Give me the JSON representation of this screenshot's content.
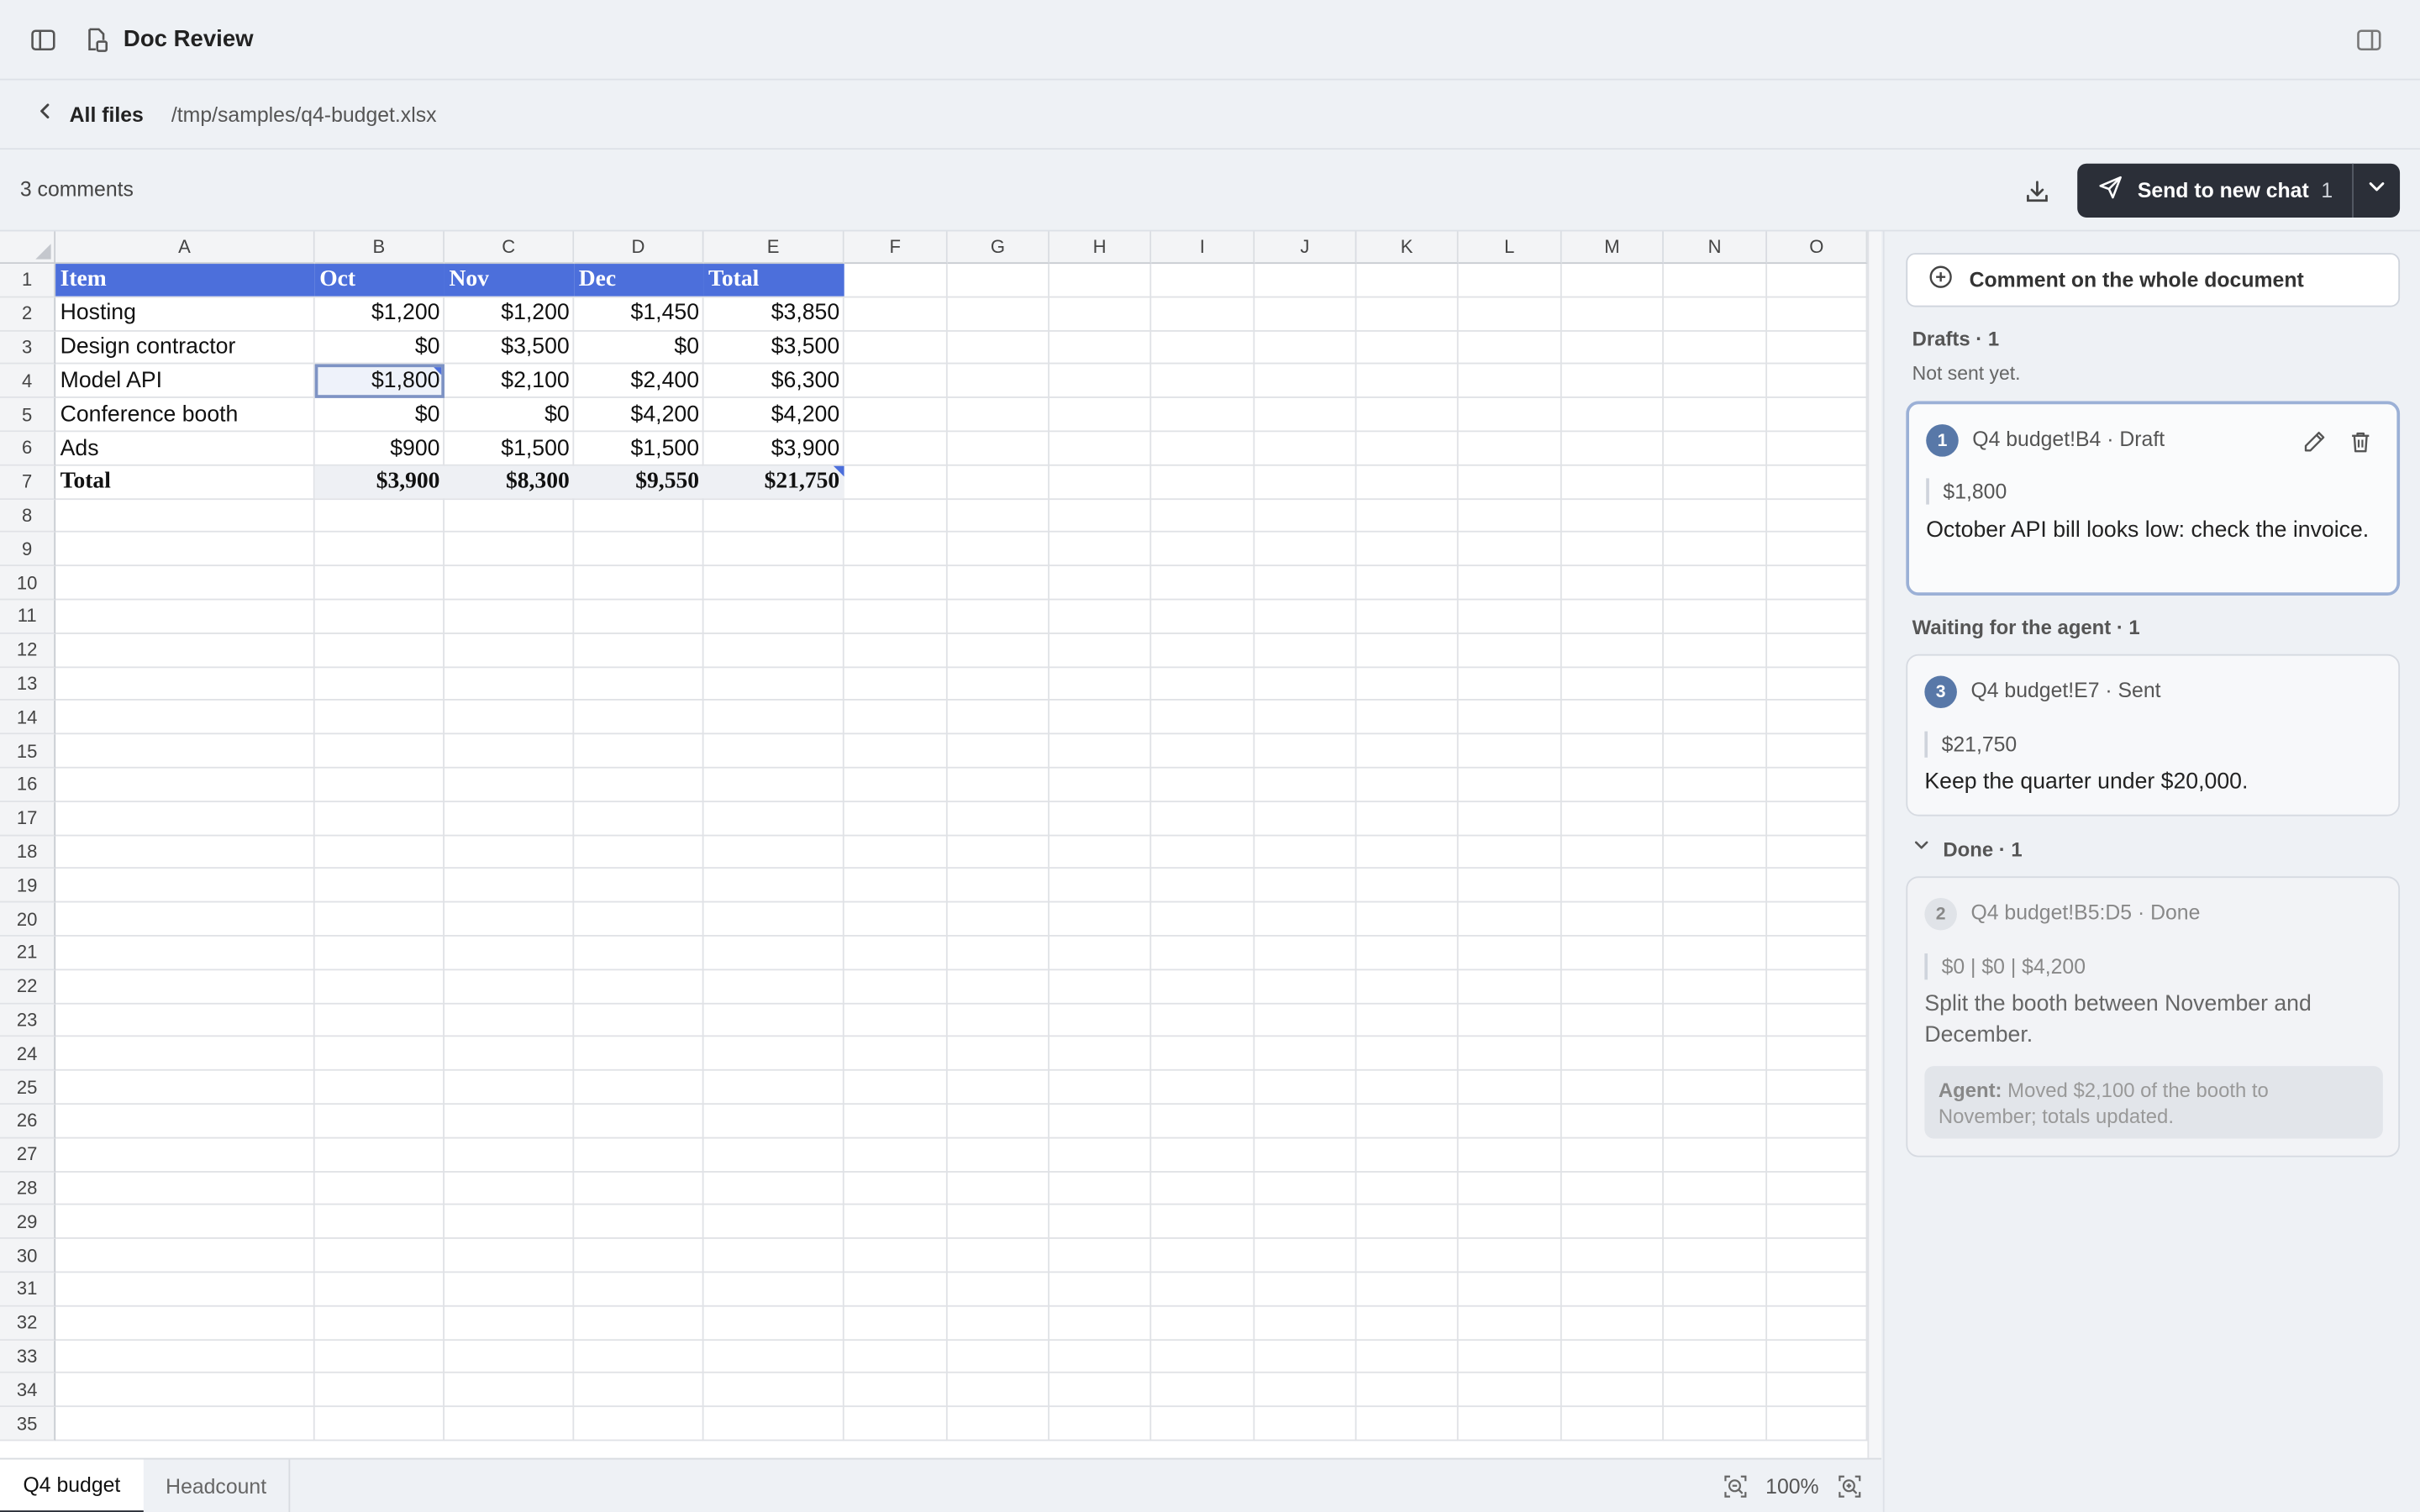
{
  "window": {
    "app_title": "Doc Review"
  },
  "breadcrumb": {
    "back_label": "All files",
    "path": "/tmp/samples/q4-budget.xlsx"
  },
  "toolbar": {
    "comment_count": "3 comments",
    "send_label": "Send to new chat",
    "send_count": "1"
  },
  "sheet": {
    "columns": [
      "A",
      "B",
      "C",
      "D",
      "E",
      "F",
      "G",
      "H",
      "I",
      "J",
      "K",
      "L",
      "M",
      "N",
      "O"
    ],
    "rows": [
      "1",
      "2",
      "3",
      "4",
      "5",
      "6",
      "7",
      "8",
      "9",
      "10",
      "11",
      "12",
      "13",
      "14",
      "15",
      "16",
      "17",
      "18",
      "19",
      "20",
      "21",
      "22",
      "23",
      "24",
      "25",
      "26",
      "27",
      "28",
      "29",
      "30",
      "31",
      "32",
      "33",
      "34",
      "35"
    ],
    "header": [
      "Item",
      "Oct",
      "Nov",
      "Dec",
      "Total"
    ],
    "data": [
      [
        "Hosting",
        "$1,200",
        "$1,200",
        "$1,450",
        "$3,850"
      ],
      [
        "Design contractor",
        "$0",
        "$3,500",
        "$0",
        "$3,500"
      ],
      [
        "Model API",
        "$1,800",
        "$2,100",
        "$2,400",
        "$6,300"
      ],
      [
        "Conference booth",
        "$0",
        "$0",
        "$4,200",
        "$4,200"
      ],
      [
        "Ads",
        "$900",
        "$1,500",
        "$1,500",
        "$3,900"
      ]
    ],
    "total": [
      "Total",
      "$3,900",
      "$8,300",
      "$9,550",
      "$21,750"
    ],
    "header_color": "#4c6fdb"
  },
  "tabs": [
    "Q4 budget",
    "Headcount"
  ],
  "zoom": "100%",
  "panel": {
    "whole_doc_label": "Comment on the whole document",
    "drafts": {
      "label": "Drafts · 1",
      "subtitle": "Not sent yet.",
      "card": {
        "badge": "1",
        "ref": "Q4 budget!B4 · Draft",
        "quote": "$1,800",
        "body": "October API bill looks low: check the invoice."
      }
    },
    "waiting": {
      "label": "Waiting for the agent · 1",
      "card": {
        "badge": "3",
        "ref": "Q4 budget!E7 · Sent",
        "quote": "$21,750",
        "body": "Keep the quarter under $20,000."
      }
    },
    "done": {
      "label": "Done · 1",
      "card": {
        "badge": "2",
        "ref": "Q4 budget!B5:D5 · Done",
        "quote": "$0 | $0 | $4,200",
        "body": "Split the booth between November and December.",
        "agent_label": "Agent:",
        "agent_text": "Moved $2,100 of the booth to November; totals updated."
      }
    }
  }
}
